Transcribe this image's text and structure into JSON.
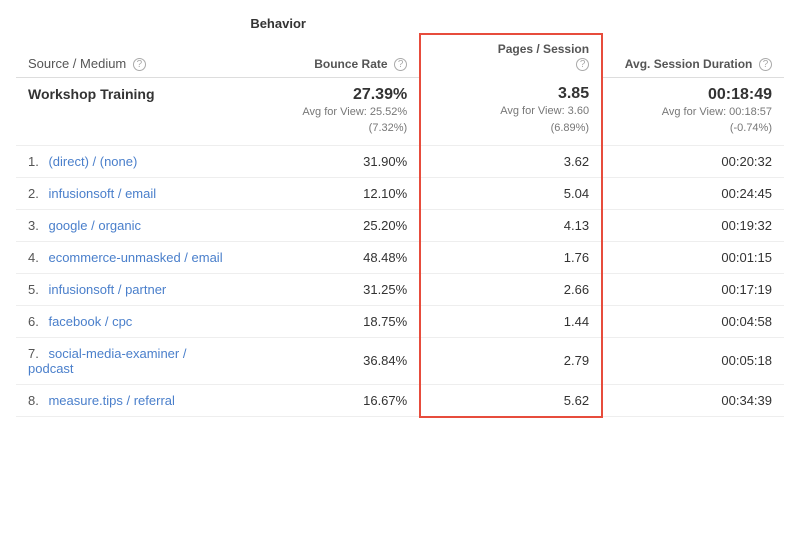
{
  "header": {
    "behavior_label": "Behavior",
    "source_medium_label": "Source / Medium",
    "bounce_rate_label": "Bounce Rate",
    "pages_session_label": "Pages / Session",
    "avg_session_label": "Avg. Session Duration"
  },
  "summary": {
    "source": "Workshop Training",
    "bounce_rate": "27.39%",
    "bounce_rate_sub": "Avg for View: 25.52%\n(7.32%)",
    "pages_session": "3.85",
    "pages_session_sub": "Avg for View: 3.60\n(6.89%)",
    "avg_session": "00:18:49",
    "avg_session_sub": "Avg for View: 00:18:57\n(-0.74%)"
  },
  "rows": [
    {
      "num": "1.",
      "source": "(direct) / (none)",
      "bounce_rate": "31.90%",
      "pages_session": "3.62",
      "avg_session": "00:20:32"
    },
    {
      "num": "2.",
      "source": "infusionsoft / email",
      "bounce_rate": "12.10%",
      "pages_session": "5.04",
      "avg_session": "00:24:45"
    },
    {
      "num": "3.",
      "source": "google / organic",
      "bounce_rate": "25.20%",
      "pages_session": "4.13",
      "avg_session": "00:19:32"
    },
    {
      "num": "4.",
      "source": "ecommerce-unmasked / email",
      "bounce_rate": "48.48%",
      "pages_session": "1.76",
      "avg_session": "00:01:15"
    },
    {
      "num": "5.",
      "source": "infusionsoft / partner",
      "bounce_rate": "31.25%",
      "pages_session": "2.66",
      "avg_session": "00:17:19"
    },
    {
      "num": "6.",
      "source": "facebook / cpc",
      "bounce_rate": "18.75%",
      "pages_session": "1.44",
      "avg_session": "00:04:58"
    },
    {
      "num": "7.",
      "source": "social-media-examiner / podcast",
      "bounce_rate": "36.84%",
      "pages_session": "2.79",
      "avg_session": "00:05:18"
    },
    {
      "num": "8.",
      "source": "measure.tips / referral",
      "bounce_rate": "16.67%",
      "pages_session": "5.62",
      "avg_session": "00:34:39"
    }
  ]
}
